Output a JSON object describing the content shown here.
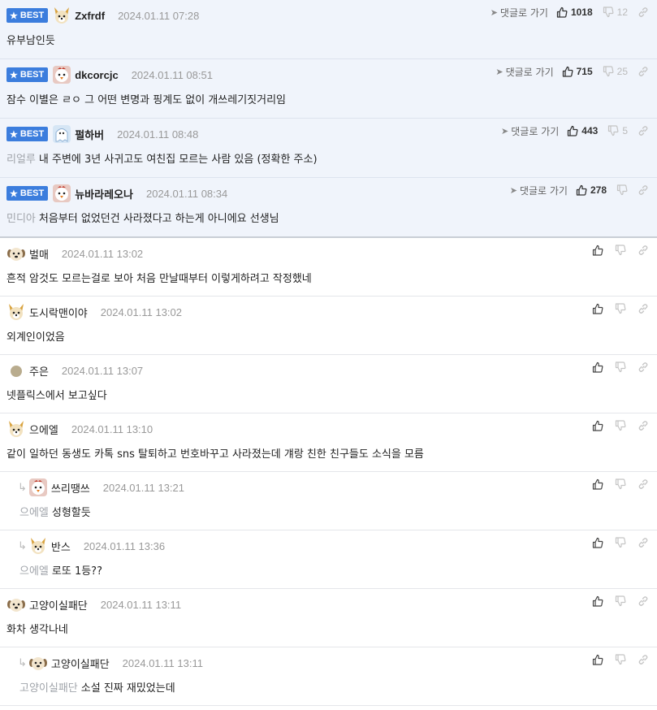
{
  "best_badge": "BEST",
  "goto_label": "댓글로 가기",
  "best": [
    {
      "user": "Zxfrdf",
      "date": "2024.01.11 07:28",
      "mention": "",
      "text": "유부남인듯",
      "likes": "1018",
      "dislikes": "12",
      "avatar": "dog"
    },
    {
      "user": "dkcorcjc",
      "date": "2024.01.11 08:51",
      "mention": "",
      "text": "잠수 이별은 ㄹㅇ 그 어떤 변명과 핑계도 없이 개쓰레기짓거리임",
      "likes": "715",
      "dislikes": "25",
      "avatar": "chicken"
    },
    {
      "user": "펄하버",
      "date": "2024.01.11 08:48",
      "mention": "리얼루",
      "text": "내 주변에 3년 사귀고도 여친집 모르는 사람 있음 (정확한 주소)",
      "likes": "443",
      "dislikes": "5",
      "avatar": "ghost"
    },
    {
      "user": "뉴바라레오나",
      "date": "2024.01.11 08:34",
      "mention": "민디아",
      "text": "처음부터 없었던건 사라졌다고 하는게 아니에요 선생님",
      "likes": "278",
      "dislikes": "",
      "avatar": "chicken"
    }
  ],
  "comments": [
    {
      "user": "벌매",
      "date": "2024.01.11 13:02",
      "mention": "",
      "text": "흔적 암것도 모르는걸로 보아 처음 만날때부터 이렇게하려고 작정했네",
      "reply": false,
      "avatar": "pup"
    },
    {
      "user": "도시락맨이야",
      "date": "2024.01.11 13:02",
      "mention": "",
      "text": "외계인이었음",
      "reply": false,
      "avatar": "dog"
    },
    {
      "user": "주은",
      "date": "2024.01.11 13:07",
      "mention": "",
      "text": "넷플릭스에서 보고싶다",
      "reply": false,
      "avatar": "dot"
    },
    {
      "user": "으에엘",
      "date": "2024.01.11 13:10",
      "mention": "",
      "text": "같이 일하던 동생도 카톡 sns 탈퇴하고 번호바꾸고 사라졌는데 걔랑 친한 친구들도 소식을 모름",
      "reply": false,
      "avatar": "dog"
    },
    {
      "user": "쓰리땡쓰",
      "date": "2024.01.11 13:21",
      "mention": "으에엘",
      "text": "성형할듯",
      "reply": true,
      "avatar": "chicken"
    },
    {
      "user": "반스",
      "date": "2024.01.11 13:36",
      "mention": "으에엘",
      "text": "로또 1등??",
      "reply": true,
      "avatar": "dog"
    },
    {
      "user": "고양이실패단",
      "date": "2024.01.11 13:11",
      "mention": "",
      "text": "화차 생각나네",
      "reply": false,
      "avatar": "pup"
    },
    {
      "user": "고양이실패단",
      "date": "2024.01.11 13:11",
      "mention": "고양이실패단",
      "text": "소설 진짜 재밌었는데",
      "reply": true,
      "avatar": "pup"
    }
  ],
  "icons": {
    "like": "thumbs-up-icon",
    "dislike": "thumbs-down-icon",
    "link": "link-icon",
    "goto": "navigate-arrow-icon",
    "reply": "reply-arrow-icon",
    "star": "star-icon"
  },
  "colors": {
    "badge": "#3b7ddd",
    "best_bg": "#f0f4fb",
    "muted": "#999999"
  }
}
